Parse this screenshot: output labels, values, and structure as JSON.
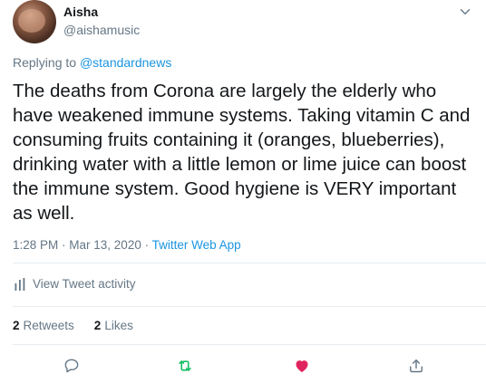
{
  "author": {
    "name": "Aisha",
    "handle": "@aishamusic"
  },
  "reply": {
    "prefix": "Replying to ",
    "to": "@standardnews"
  },
  "tweet": {
    "text": "The deaths from Corona are largely the elderly who have weakened immune systems. Taking vitamin C and consuming fruits containing it (oranges, blueberries), drinking water with a little lemon or lime juice can boost the immune system. Good hygiene is VERY important as well."
  },
  "meta": {
    "time": "1:28 PM",
    "separator1": " · ",
    "date": "Mar 13, 2020",
    "separator2": " · ",
    "source": "Twitter Web App"
  },
  "activity": {
    "label": "View Tweet activity",
    "icon": "bar-chart-icon"
  },
  "stats": {
    "retweets_count": "2",
    "retweets_label": "Retweets",
    "likes_count": "2",
    "likes_label": "Likes"
  },
  "actions": [
    {
      "name": "reply",
      "icon": "speech-bubble-icon",
      "color": "#657786"
    },
    {
      "name": "retweet",
      "icon": "retweet-icon",
      "color": "#17bf63"
    },
    {
      "name": "like",
      "icon": "heart-icon",
      "color": "#e0245e"
    },
    {
      "name": "share",
      "icon": "share-icon",
      "color": "#657786"
    }
  ],
  "colors": {
    "link": "#1b95e0",
    "secondary_text": "#657786",
    "retweeted": "#17bf63",
    "liked": "#e0245e"
  }
}
